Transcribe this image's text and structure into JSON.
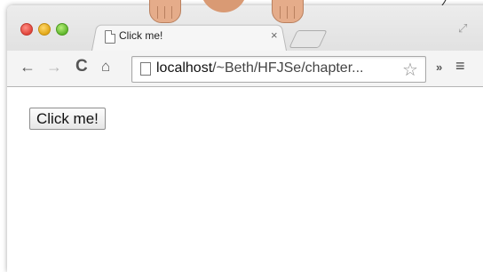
{
  "window": {
    "controls": [
      "close",
      "minimize",
      "zoom"
    ]
  },
  "tabs": [
    {
      "title": "Click me!",
      "icon": "page-icon",
      "close_glyph": "×"
    }
  ],
  "toolbar": {
    "back_glyph": "←",
    "forward_glyph": "→",
    "reload_glyph": "C",
    "home_glyph": "⌂",
    "extensions_glyph": "»",
    "menu_glyph": "≡",
    "fullscreen_glyph": "⤢"
  },
  "omnibox": {
    "host": "localhost",
    "path": "/~Beth/HFJSe/chapter...",
    "star_glyph": "☆"
  },
  "page": {
    "button_label": "Click me!"
  },
  "colors": {
    "chrome_bg": "#ececec",
    "page_bg": "#ffffff"
  }
}
